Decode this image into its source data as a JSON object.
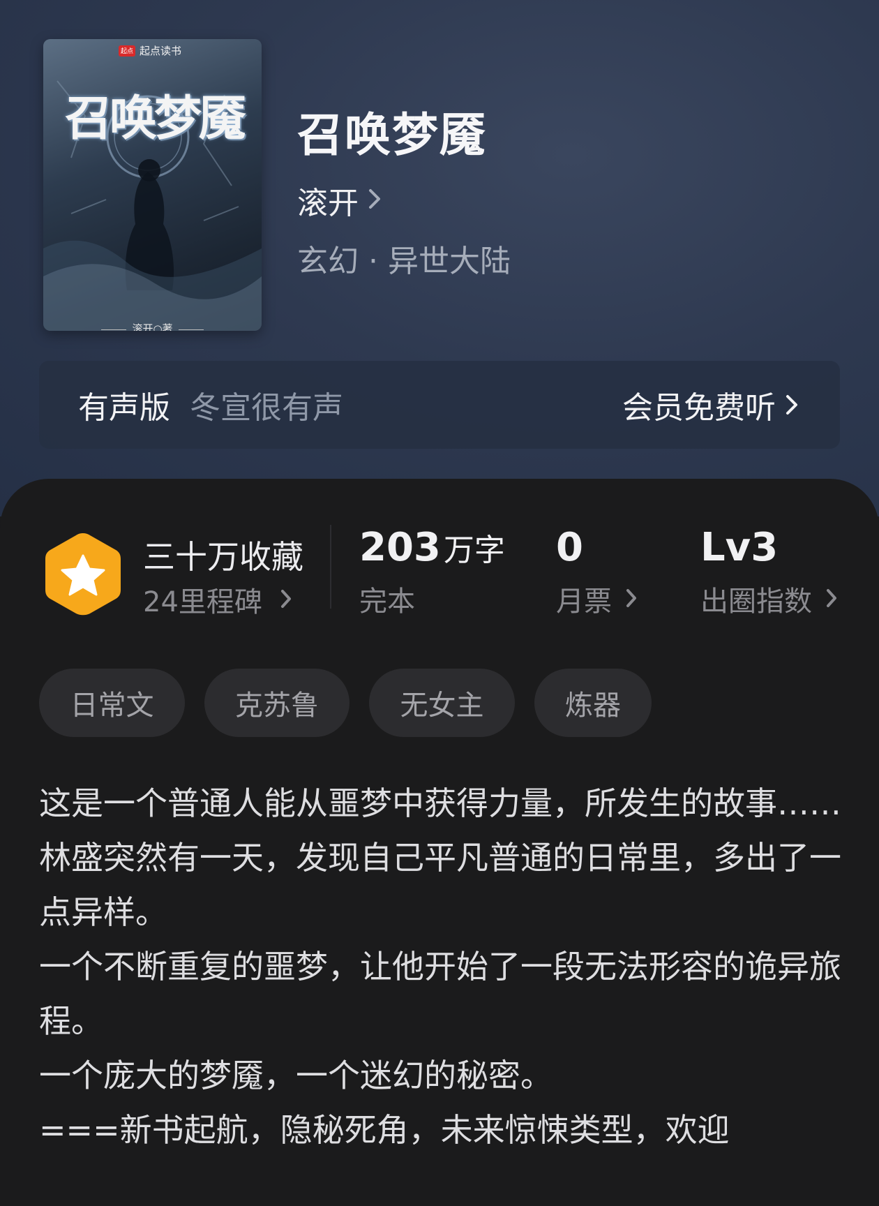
{
  "book": {
    "cover_brand": "起点读书",
    "cover_brand_mark": "起点",
    "cover_title": "召唤梦魇",
    "cover_author": "滚开○著",
    "title": "召唤梦魇",
    "author": "滚开",
    "genre": "玄幻 · 异世大陆"
  },
  "audio": {
    "label": "有声版",
    "narrator": "冬宣很有声",
    "link": "会员免费听"
  },
  "stats": {
    "favorites_main": "三十万收藏",
    "favorites_sub": "24里程碑",
    "words_value": "203",
    "words_unit": "万字",
    "words_sub": "完本",
    "monthly_value": "0",
    "monthly_sub": "月票",
    "index_value": "Lv3",
    "index_sub": "出圈指数"
  },
  "tags": [
    "日常文",
    "克苏鲁",
    "无女主",
    "炼器"
  ],
  "intro": [
    "这是一个普通人能从噩梦中获得力量，所发生的故事……",
    "林盛突然有一天，发现自己平凡普通的日常里，多出了一点异样。",
    "一个不断重复的噩梦，让他开始了一段无法形容的诡异旅程。",
    "一个庞大的梦魇，一个迷幻的秘密。",
    "===新书起航，隐秘死角，未来惊悚类型，欢迎"
  ],
  "colors": {
    "badge": "#f7a81b",
    "header_bg": "#2e3950",
    "card_bg": "#1b1b1c"
  },
  "icons": {
    "chevron": "chevron-right-icon",
    "badge": "star-hexagon-icon"
  }
}
